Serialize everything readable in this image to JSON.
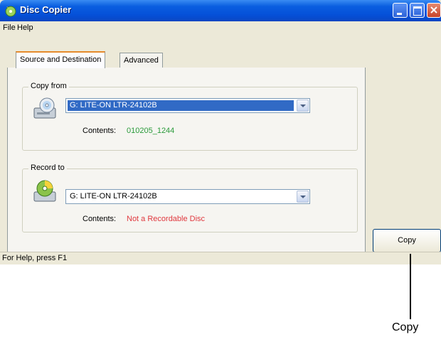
{
  "window": {
    "title": "Disc Copier"
  },
  "menubar": {
    "items": [
      {
        "label": "File"
      },
      {
        "label": "Help"
      }
    ]
  },
  "tabs": [
    {
      "label": "Source and Destination",
      "active": true
    },
    {
      "label": "Advanced",
      "active": false
    }
  ],
  "copy_from": {
    "group_label": "Copy from",
    "drive_icon": "cd-drive-icon",
    "drive_value": "G: LITE-ON LTR-24102B",
    "contents_label": "Contents:",
    "contents_value": "010205_1244",
    "contents_color": "#2a9a3a"
  },
  "record_to": {
    "group_label": "Record to",
    "drive_icon": "cd-burn-icon",
    "drive_value": "G: LITE-ON LTR-24102B",
    "contents_label": "Contents:",
    "contents_value": "Not a Recordable Disc",
    "contents_color": "#e0383e"
  },
  "actions": {
    "copy_label": "Copy"
  },
  "status": {
    "text": "For Help, press F1"
  },
  "callout": {
    "label": "Copy"
  },
  "colors": {
    "titlebar": "#0a5ee0",
    "selection": "#316ac5"
  }
}
